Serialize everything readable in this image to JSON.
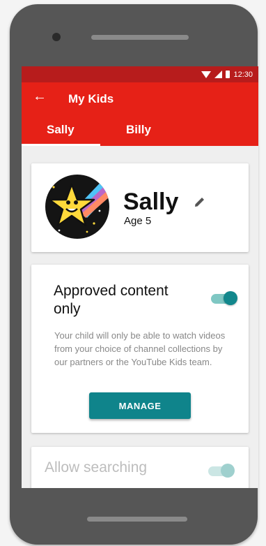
{
  "status_bar": {
    "time": "12:30"
  },
  "app_bar": {
    "back_icon": "arrow-left-icon",
    "title": "My Kids"
  },
  "tabs": [
    {
      "label": "Sally",
      "selected": true
    },
    {
      "label": "Billy",
      "selected": false
    }
  ],
  "profile": {
    "name": "Sally",
    "age": "Age 5",
    "edit_icon": "pencil-icon",
    "avatar_icon": "star-avatar"
  },
  "approved_content": {
    "title": "Approved content only",
    "description": "Your child will only be able to watch videos from your choice of channel collections by our partners or the YouTube Kids team.",
    "toggle_on": true,
    "button_label": "MANAGE"
  },
  "allow_searching": {
    "label": "Allow searching",
    "toggle_on": true,
    "disabled": true
  },
  "colors": {
    "app_bar": "#e62117",
    "status_bar": "#b71c1c",
    "accent": "#0f848b",
    "toggle_track": "#7fc7c3"
  }
}
